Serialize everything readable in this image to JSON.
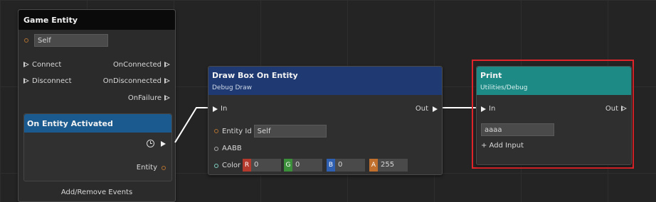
{
  "game_entity": {
    "title": "Game Entity",
    "self_value": "Self",
    "connect": "Connect",
    "disconnect": "Disconnect",
    "on_connected": "OnConnected",
    "on_disconnected": "OnDisconnected",
    "on_failure": "OnFailure",
    "on_entity_activated": "On Entity Activated",
    "entity": "Entity",
    "add_remove_events": "Add/Remove Events"
  },
  "draw_box": {
    "title": "Draw Box On Entity",
    "subtitle": "Debug Draw",
    "in": "In",
    "out": "Out",
    "entity_id_label": "Entity Id",
    "entity_id_value": "Self",
    "aabb": "AABB",
    "color_label": "Color",
    "r_label": "R",
    "r_value": "0",
    "g_label": "G",
    "g_value": "0",
    "b_label": "B",
    "b_value": "0",
    "a_label": "A",
    "a_value": "255"
  },
  "print": {
    "title": "Print",
    "subtitle": "Utilities/Debug",
    "in": "In",
    "out": "Out",
    "text_value": "aaaa",
    "add_input": "+ Add Input"
  },
  "colors": {
    "game_entity_header": "#0a0a0a",
    "on_entity_activated_header": "#1b5a8e",
    "draw_box_header": "#1f3a72",
    "print_header": "#1e8a86",
    "selection": "#e0242a"
  }
}
